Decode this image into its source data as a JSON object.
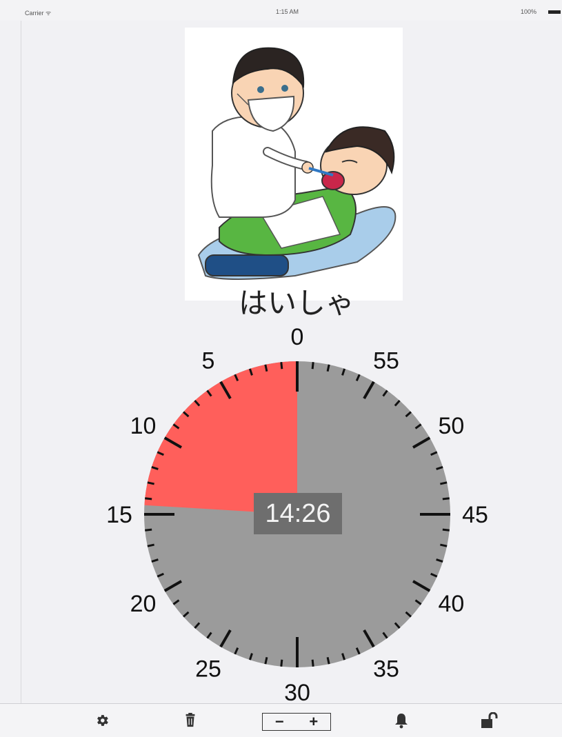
{
  "status_bar": {
    "carrier": "Carrier ᯤ",
    "time": "1:15 AM",
    "battery": "100%"
  },
  "activity": {
    "label": "はいしゃ",
    "illustration": "dentist-illustration"
  },
  "timer": {
    "readout": "14:26",
    "remaining_minutes": 14.43,
    "dial_labels": [
      "0",
      "5",
      "10",
      "15",
      "20",
      "25",
      "30",
      "35",
      "40",
      "45",
      "50",
      "55"
    ],
    "colors": {
      "remaining": "#ff5f5b",
      "face": "#9b9b9b",
      "ticks": "#111111"
    }
  },
  "toolbar": {
    "icons": [
      "gear-icon",
      "trash-icon",
      "bell-icon",
      "unlock-icon"
    ],
    "minus_label": "−",
    "plus_label": "+"
  }
}
